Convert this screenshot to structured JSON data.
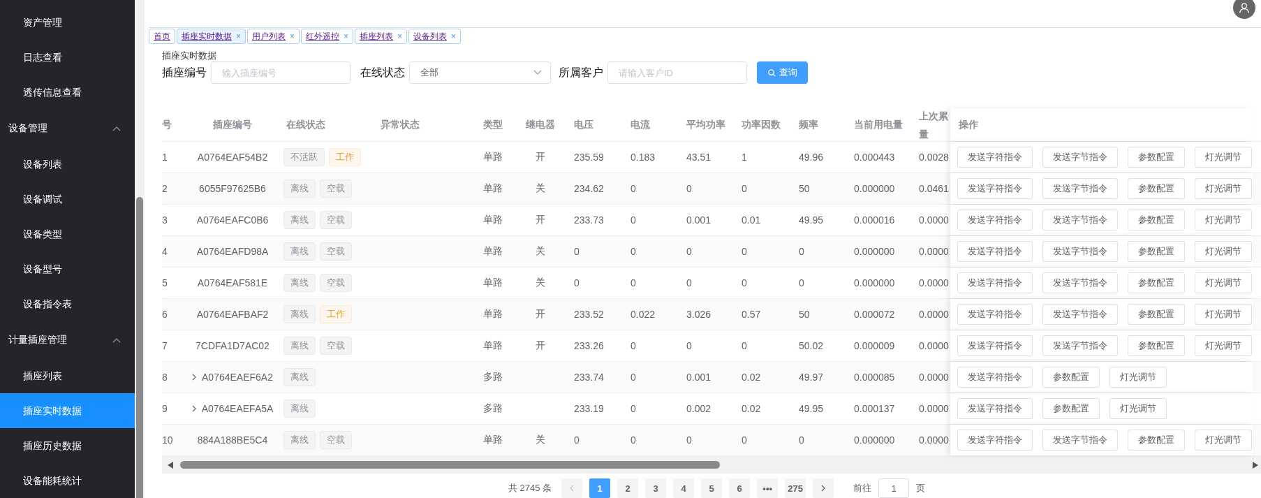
{
  "sidebar": {
    "items": [
      {
        "label": "资产管理",
        "selected": false
      },
      {
        "label": "日志查看",
        "selected": false
      },
      {
        "label": "透传信息查看",
        "selected": false
      },
      {
        "label": "设备管理",
        "expanded": true,
        "children": [
          {
            "label": "设备列表",
            "selected": false
          },
          {
            "label": "设备调试",
            "selected": false
          },
          {
            "label": "设备类型",
            "selected": false
          },
          {
            "label": "设备型号",
            "selected": false
          },
          {
            "label": "设备指令表",
            "selected": false
          }
        ]
      },
      {
        "label": "计量插座管理",
        "expanded": true,
        "children": [
          {
            "label": "插座列表",
            "selected": false
          },
          {
            "label": "插座实时数据",
            "selected": true
          },
          {
            "label": "插座历史数据",
            "selected": false
          },
          {
            "label": "设备能耗统计",
            "selected": false
          }
        ]
      }
    ]
  },
  "tabs": [
    {
      "label": "首页",
      "selected": false,
      "closable": false
    },
    {
      "label": "插座实时数据",
      "selected": true,
      "closable": true
    },
    {
      "label": "用户列表",
      "selected": false,
      "closable": true
    },
    {
      "label": "红外遥控",
      "selected": false,
      "closable": true
    },
    {
      "label": "插座列表",
      "selected": false,
      "closable": true
    },
    {
      "label": "设备列表",
      "selected": false,
      "closable": true
    }
  ],
  "close_glyph": "×",
  "page_title": "插座实时数据",
  "filters": [
    {
      "kind": "input",
      "label": "插座编号",
      "placeholder": "输入插座编号"
    },
    {
      "kind": "select",
      "label": "在线状态",
      "value": "全部"
    },
    {
      "kind": "input",
      "label": "所属客户",
      "placeholder": "请输入客户ID"
    }
  ],
  "query_button": "查询",
  "table": {
    "columns": [
      "号",
      "插座编号",
      "在线状态",
      "异常状态",
      "类型",
      "继电器",
      "电压",
      "电流",
      "平均功率",
      "功率因数",
      "频率",
      "当前用电量",
      "上次累量",
      "操作"
    ],
    "rows": [
      {
        "index": "1",
        "socket_id": "A0764EAF54B2",
        "expandable": false,
        "status_tags": [
          {
            "text": "不活跃",
            "kind": "info"
          },
          {
            "text": "工作",
            "kind": "warning"
          }
        ],
        "type": "单路",
        "relay": "开",
        "voltage": "235.59",
        "current": "0.183",
        "avg_power": "43.51",
        "power_factor": "1",
        "frequency": "49.96",
        "current_energy": "0.000443",
        "last_total": "0.0028",
        "actions": [
          "发送字符指令",
          "发送字节指令",
          "参数配置",
          "灯光调节"
        ]
      },
      {
        "index": "2",
        "socket_id": "6055F97625B6",
        "expandable": false,
        "status_tags": [
          {
            "text": "离线",
            "kind": "info"
          },
          {
            "text": "空载",
            "kind": "info"
          }
        ],
        "type": "单路",
        "relay": "关",
        "voltage": "234.62",
        "current": "0",
        "avg_power": "0",
        "power_factor": "0",
        "frequency": "50",
        "current_energy": "0.000000",
        "last_total": "0.0461",
        "actions": [
          "发送字符指令",
          "发送字节指令",
          "参数配置",
          "灯光调节"
        ]
      },
      {
        "index": "3",
        "socket_id": "A0764EAFC0B6",
        "expandable": false,
        "status_tags": [
          {
            "text": "离线",
            "kind": "info"
          },
          {
            "text": "空载",
            "kind": "info"
          }
        ],
        "type": "单路",
        "relay": "开",
        "voltage": "233.73",
        "current": "0",
        "avg_power": "0.001",
        "power_factor": "0.01",
        "frequency": "49.95",
        "current_energy": "0.000016",
        "last_total": "0.0000",
        "actions": [
          "发送字符指令",
          "发送字节指令",
          "参数配置",
          "灯光调节"
        ]
      },
      {
        "index": "4",
        "socket_id": "A0764EAFD98A",
        "expandable": false,
        "status_tags": [
          {
            "text": "离线",
            "kind": "info"
          },
          {
            "text": "空载",
            "kind": "info"
          }
        ],
        "type": "单路",
        "relay": "关",
        "voltage": "0",
        "current": "0",
        "avg_power": "0",
        "power_factor": "0",
        "frequency": "0",
        "current_energy": "0.000000",
        "last_total": "0.0000",
        "actions": [
          "发送字符指令",
          "发送字节指令",
          "参数配置",
          "灯光调节"
        ]
      },
      {
        "index": "5",
        "socket_id": "A0764EAF581E",
        "expandable": false,
        "status_tags": [
          {
            "text": "离线",
            "kind": "info"
          },
          {
            "text": "空载",
            "kind": "info"
          }
        ],
        "type": "单路",
        "relay": "关",
        "voltage": "0",
        "current": "0",
        "avg_power": "0",
        "power_factor": "0",
        "frequency": "0",
        "current_energy": "0.000000",
        "last_total": "0.0000",
        "actions": [
          "发送字符指令",
          "发送字节指令",
          "参数配置",
          "灯光调节"
        ]
      },
      {
        "index": "6",
        "socket_id": "A0764EAFBAF2",
        "expandable": false,
        "status_tags": [
          {
            "text": "离线",
            "kind": "info"
          },
          {
            "text": "工作",
            "kind": "warning"
          }
        ],
        "type": "单路",
        "relay": "开",
        "voltage": "233.52",
        "current": "0.022",
        "avg_power": "3.026",
        "power_factor": "0.57",
        "frequency": "50",
        "current_energy": "0.000072",
        "last_total": "0.0000",
        "actions": [
          "发送字符指令",
          "发送字节指令",
          "参数配置",
          "灯光调节"
        ]
      },
      {
        "index": "7",
        "socket_id": "7CDFA1D7AC02",
        "expandable": false,
        "status_tags": [
          {
            "text": "离线",
            "kind": "info"
          },
          {
            "text": "空载",
            "kind": "info"
          }
        ],
        "type": "单路",
        "relay": "开",
        "voltage": "233.26",
        "current": "0",
        "avg_power": "0",
        "power_factor": "0",
        "frequency": "50.02",
        "current_energy": "0.000009",
        "last_total": "0.0000",
        "actions": [
          "发送字符指令",
          "发送字节指令",
          "参数配置",
          "灯光调节"
        ]
      },
      {
        "index": "8",
        "socket_id": "A0764EAEF6A2",
        "expandable": true,
        "status_tags": [
          {
            "text": "离线",
            "kind": "info"
          }
        ],
        "type": "多路",
        "voltage": "233.74",
        "current": "0",
        "avg_power": "0.001",
        "power_factor": "0.02",
        "frequency": "49.97",
        "current_energy": "0.000085",
        "last_total": "0.0000",
        "actions": [
          "发送字符指令",
          "参数配置",
          "灯光调节"
        ]
      },
      {
        "index": "9",
        "socket_id": "A0764EAEFA5A",
        "expandable": true,
        "status_tags": [
          {
            "text": "离线",
            "kind": "info"
          }
        ],
        "type": "多路",
        "voltage": "233.19",
        "current": "0",
        "avg_power": "0.002",
        "power_factor": "0.02",
        "frequency": "49.95",
        "current_energy": "0.000137",
        "last_total": "0.0000",
        "actions": [
          "发送字符指令",
          "参数配置",
          "灯光调节"
        ]
      },
      {
        "index": "10",
        "socket_id": "884A188BE5C4",
        "expandable": false,
        "status_tags": [
          {
            "text": "离线",
            "kind": "info"
          },
          {
            "text": "空载",
            "kind": "info"
          }
        ],
        "type": "单路",
        "relay": "关",
        "voltage": "0",
        "current": "0",
        "avg_power": "0",
        "power_factor": "0",
        "frequency": "0",
        "current_energy": "0.000000",
        "last_total": "0.0000",
        "actions": [
          "发送字符指令",
          "发送字节指令",
          "参数配置",
          "灯光调节"
        ]
      }
    ]
  },
  "pagination": {
    "total": "共 2745 条",
    "pages": [
      {
        "label": "1",
        "selected": true
      },
      {
        "label": "2",
        "selected": false
      },
      {
        "label": "3",
        "selected": false
      },
      {
        "label": "4",
        "selected": false
      },
      {
        "label": "5",
        "selected": false
      },
      {
        "label": "6",
        "selected": false
      },
      {
        "label": "•••",
        "selected": false
      },
      {
        "label": "275",
        "selected": false
      }
    ],
    "goto_label": "前往",
    "goto_value": "1",
    "page_unit": "页"
  }
}
